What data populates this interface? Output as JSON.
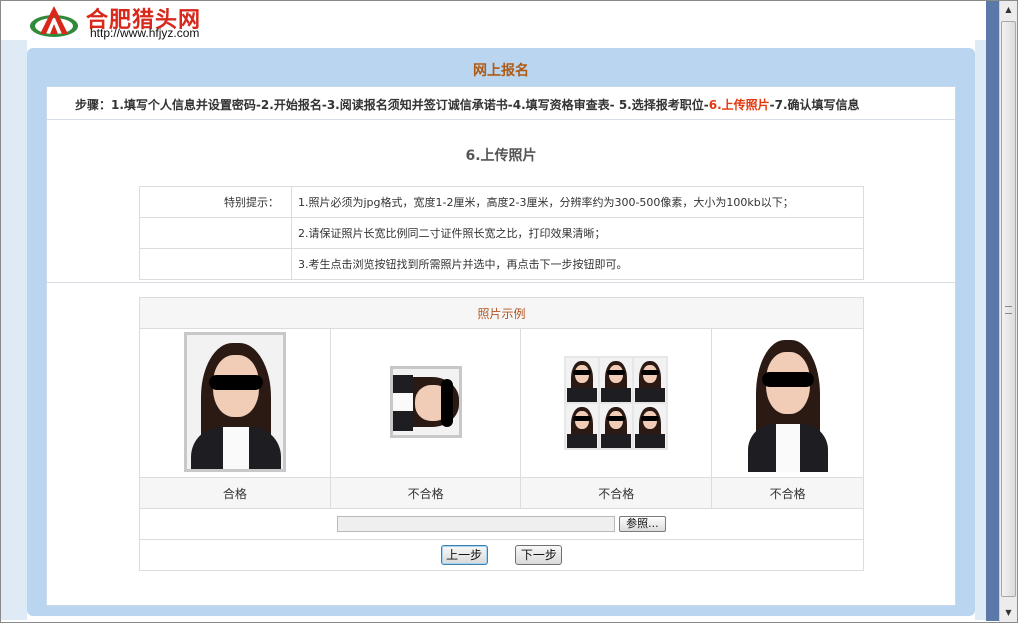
{
  "header": {
    "site_name": "合肥猎头网",
    "url": "http://www.hfjyz.com"
  },
  "panel": {
    "title": "网上报名"
  },
  "steps": {
    "prefix": "步骤：",
    "s1": "1.填写个人信息并设置密码",
    "sep": "-",
    "s2": "2.开始报名",
    "s3": "3.阅读报名须知并签订诚信承诺书",
    "s4": "4.填写资格审查表",
    "s5": " 5.选择报考职位",
    "s6": "6.上传照片",
    "s7": "7.确认填写信息"
  },
  "section_title": "6.上传照片",
  "tips": {
    "label": "特别提示：",
    "items": [
      "1.照片必须为jpg格式，宽度1-2厘米，高度2-3厘米，分辨率约为300-500像素，大小为100kb以下；",
      "2.请保证照片长宽比例同二寸证件照长宽之比，打印效果清晰；",
      "3.考生点击浏览按钮找到所需照片并选中，再点击下一步按钮即可。"
    ]
  },
  "photos": {
    "header": "照片示例",
    "captions": [
      "合格",
      "不合格",
      "不合格",
      "不合格"
    ]
  },
  "upload": {
    "browse_label": "参照..."
  },
  "buttons": {
    "prev": "上一步",
    "next": "下一步"
  },
  "icons": {
    "logo": "site-logo-icon",
    "scroll_up": "scroll-up-icon",
    "scroll_down": "scroll-down-icon"
  },
  "colors": {
    "panel_bg": "#b9d5f0",
    "current_step": "#e2380f",
    "title": "#b05a10",
    "logo_red": "#d8281c"
  }
}
